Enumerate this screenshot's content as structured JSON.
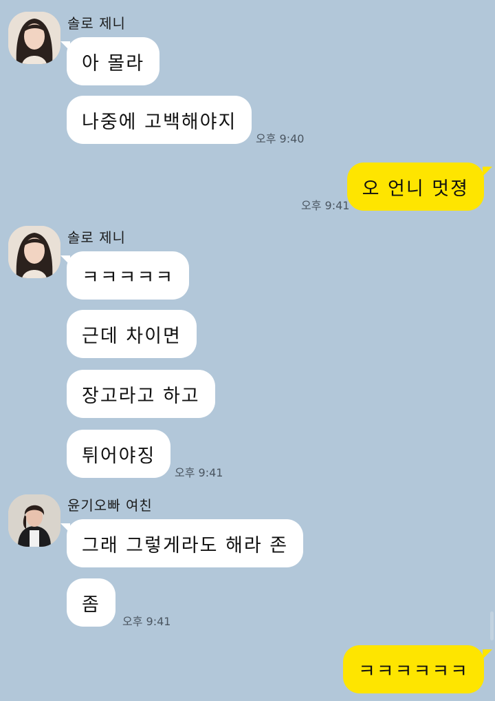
{
  "groups": [
    {
      "sender": "솔로 제니",
      "avatar_icon": "profile-photo-jennie",
      "messages": [
        "아 몰라",
        "나중에 고백해야지"
      ],
      "time": "오후 9:40"
    },
    {
      "outgoing": true,
      "messages": [
        "오 언니 멋졍"
      ],
      "time": "오후 9:41"
    },
    {
      "sender": "솔로 제니",
      "avatar_icon": "profile-photo-jennie",
      "messages": [
        "ㅋㅋㅋㅋㅋ",
        "근데 차이면",
        "장고라고 하고",
        "튀어야징"
      ],
      "time": "오후 9:41"
    },
    {
      "sender": "윤기오빠 여친",
      "avatar_icon": "profile-photo-girlfriend",
      "messages": [
        "그래 그렇게라도 해라 존",
        "좀"
      ],
      "time": "오후 9:41"
    },
    {
      "outgoing": true,
      "messages": [
        "ㅋㅋㅋㅋㅋㅋ"
      ]
    }
  ],
  "colors": {
    "background": "#b2c7d9",
    "incoming_bubble": "#ffffff",
    "outgoing_bubble": "#fee500"
  }
}
